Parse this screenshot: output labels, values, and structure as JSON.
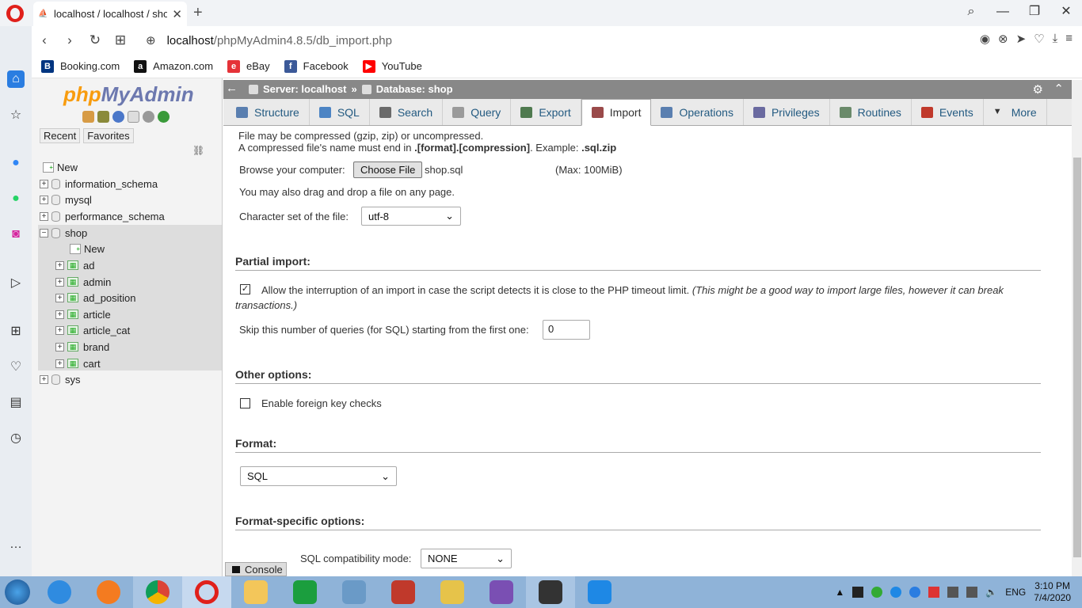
{
  "browser": {
    "tab_title": "localhost / localhost / shop",
    "tab_icon": "pma-favicon",
    "url_host": "localhost",
    "url_path": "/phpMyAdmin4.8.5/db_import.php",
    "bookmarks": [
      {
        "label": "Booking.com",
        "color": "#003580",
        "glyph": "B"
      },
      {
        "label": "Amazon.com",
        "color": "#111111",
        "glyph": "a"
      },
      {
        "label": "eBay",
        "color": "#e53238",
        "glyph": "e"
      },
      {
        "label": "Facebook",
        "color": "#3b5998",
        "glyph": "f"
      },
      {
        "label": "YouTube",
        "color": "#ff0000",
        "glyph": "▶"
      }
    ]
  },
  "pma": {
    "logo_php": "php",
    "logo_myadmin": "MyAdmin",
    "recent": "Recent",
    "favorites": "Favorites",
    "tree": {
      "new_root": "New",
      "information_schema": "information_schema",
      "mysql": "mysql",
      "performance_schema": "performance_schema",
      "shop": "shop",
      "new_shop": "New",
      "tables": [
        "ad",
        "admin",
        "ad_position",
        "article",
        "article_cat",
        "brand",
        "cart"
      ],
      "sys": "sys"
    },
    "breadcrumb": {
      "server": "Server: localhost",
      "sep": "»",
      "database": "Database: shop"
    },
    "tabs": [
      "Structure",
      "SQL",
      "Search",
      "Query",
      "Export",
      "Import",
      "Operations",
      "Privileges",
      "Routines",
      "Events",
      "More"
    ],
    "active_tab": "Import",
    "import": {
      "compress_line1": "File may be compressed (gzip, zip) or uncompressed.",
      "compress_line2a": "A compressed file's name must end in ",
      "compress_line2b": ".[format].[compression]",
      "compress_line2c": ". Example: ",
      "compress_line2d": ".sql.zip",
      "browse_label": "Browse your computer:",
      "choose_file": "Choose File",
      "file_name": "shop.sql",
      "max_size": "(Max: 100MiB)",
      "drag_drop": "You may also drag and drop a file on any page.",
      "charset_label": "Character set of the file:",
      "charset_value": "utf-8",
      "partial_heading": "Partial import:",
      "allow_interrupt": "Allow the interruption of an import in case the script detects it is close to the PHP timeout limit.",
      "allow_interrupt_note": "(This might be a good way to import large files, however it can break",
      "allow_interrupt_note2": "transactions.)",
      "allow_interrupt_checked": true,
      "skip_label": "Skip this number of queries (for SQL) starting from the first one:",
      "skip_value": "0",
      "other_heading": "Other options:",
      "fk_checks": "Enable foreign key checks",
      "fk_checks_checked": false,
      "format_heading": "Format:",
      "format_value": "SQL",
      "format_specific_heading": "Format-specific options:",
      "compat_label": "SQL compatibility mode:",
      "compat_value": "NONE"
    },
    "console": "Console"
  },
  "taskbar": {
    "lang": "ENG",
    "time": "3:10 PM",
    "date": "7/4/2020"
  }
}
